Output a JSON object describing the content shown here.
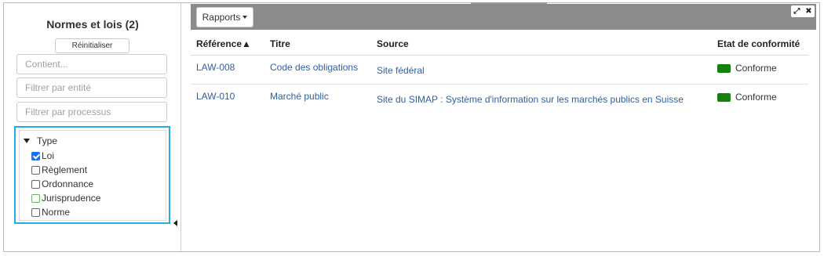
{
  "sidebar": {
    "title": "Normes et lois (2)",
    "reset_label": "Réinitialiser",
    "filters": {
      "contains_placeholder": "Contient...",
      "entity_placeholder": "Filtrer par entité",
      "process_placeholder": "Filtrer par processus"
    },
    "type_filter": {
      "header": "Type",
      "options": [
        {
          "label": "Loi",
          "checked": true
        },
        {
          "label": "Règlement",
          "checked": false
        },
        {
          "label": "Ordonnance",
          "checked": false
        },
        {
          "label": "Jurisprudence",
          "checked": false
        },
        {
          "label": "Norme",
          "checked": false
        }
      ]
    }
  },
  "toolbar": {
    "reports_label": "Rapports",
    "expand_icon": "expand-icon",
    "close_icon": "close-icon"
  },
  "table": {
    "columns": {
      "reference": "Référence",
      "sort_indicator": "▲",
      "title": "Titre",
      "source": "Source",
      "status": "Etat de conformité"
    },
    "rows": [
      {
        "reference": "LAW-008",
        "title": "Code des obligations",
        "source": "Site fédéral",
        "status": "Conforme",
        "status_color": "#15820f"
      },
      {
        "reference": "LAW-010",
        "title": "Marché public",
        "source": "Site du SIMAP : Système d'information sur les marchés publics en Suisse",
        "status": "Conforme",
        "status_color": "#15820f"
      }
    ]
  },
  "colors": {
    "accent": "#29abe2",
    "toolbar_bg": "#8b8b8b",
    "link": "#2f5fa0",
    "checkbox_checked": "#1a73e8"
  }
}
